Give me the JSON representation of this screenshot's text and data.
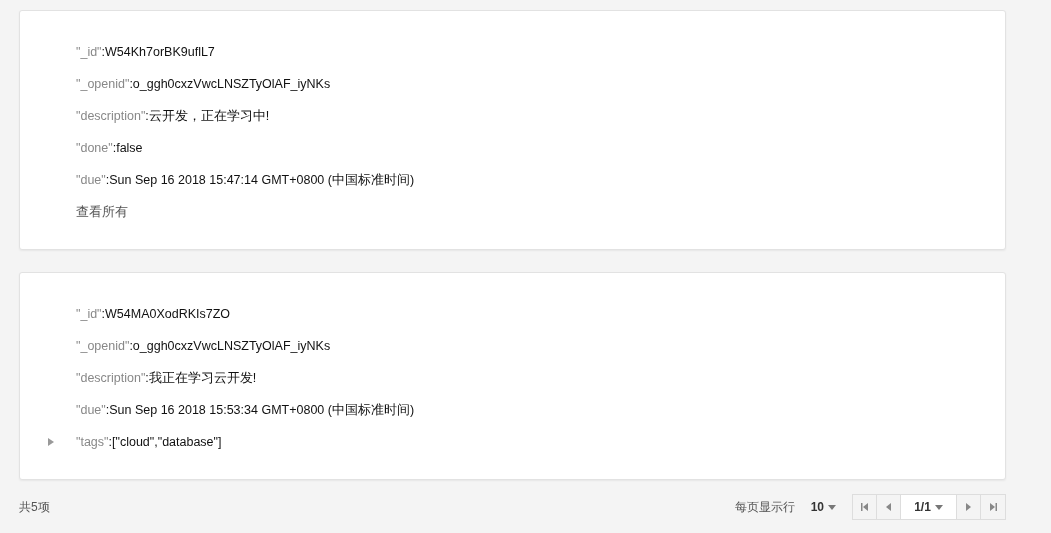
{
  "records": [
    {
      "fields": [
        {
          "kind": "leaf",
          "key": "\"_id\"",
          "value": ":W54Kh7orBK9uflL7"
        },
        {
          "kind": "leaf",
          "key": "\"_openid\"",
          "value": ":o_ggh0cxzVwcLNSZTyOlAF_iyNKs"
        },
        {
          "kind": "leaf",
          "key": "\"description\"",
          "value": ":云开发，正在学习中!"
        },
        {
          "kind": "leaf",
          "key": "\"done\"",
          "value": ":false"
        },
        {
          "kind": "leaf",
          "key": "\"due\"",
          "value": ":Sun Sep 16 2018 15:47:14 GMT+0800 (中国标准时间)"
        }
      ],
      "link": "查看所有"
    },
    {
      "fields": [
        {
          "kind": "leaf",
          "key": "\"_id\"",
          "value": ":W54MA0XodRKIs7ZO"
        },
        {
          "kind": "leaf",
          "key": "\"_openid\"",
          "value": ":o_ggh0cxzVwcLNSZTyOlAF_iyNKs"
        },
        {
          "kind": "leaf",
          "key": "\"description\"",
          "value": ":我正在学习云开发!"
        },
        {
          "kind": "leaf",
          "key": "\"due\"",
          "value": ":Sun Sep 16 2018 15:53:34 GMT+0800 (中国标准时间)"
        },
        {
          "kind": "collapsible",
          "key": "\"tags\"",
          "value": ":[\"cloud\",\"database\"]",
          "expanded": false
        }
      ]
    }
  ],
  "footer": {
    "total": "共5项",
    "page_size_label": "每页显示行",
    "page_size": "10",
    "page": "1/1"
  }
}
